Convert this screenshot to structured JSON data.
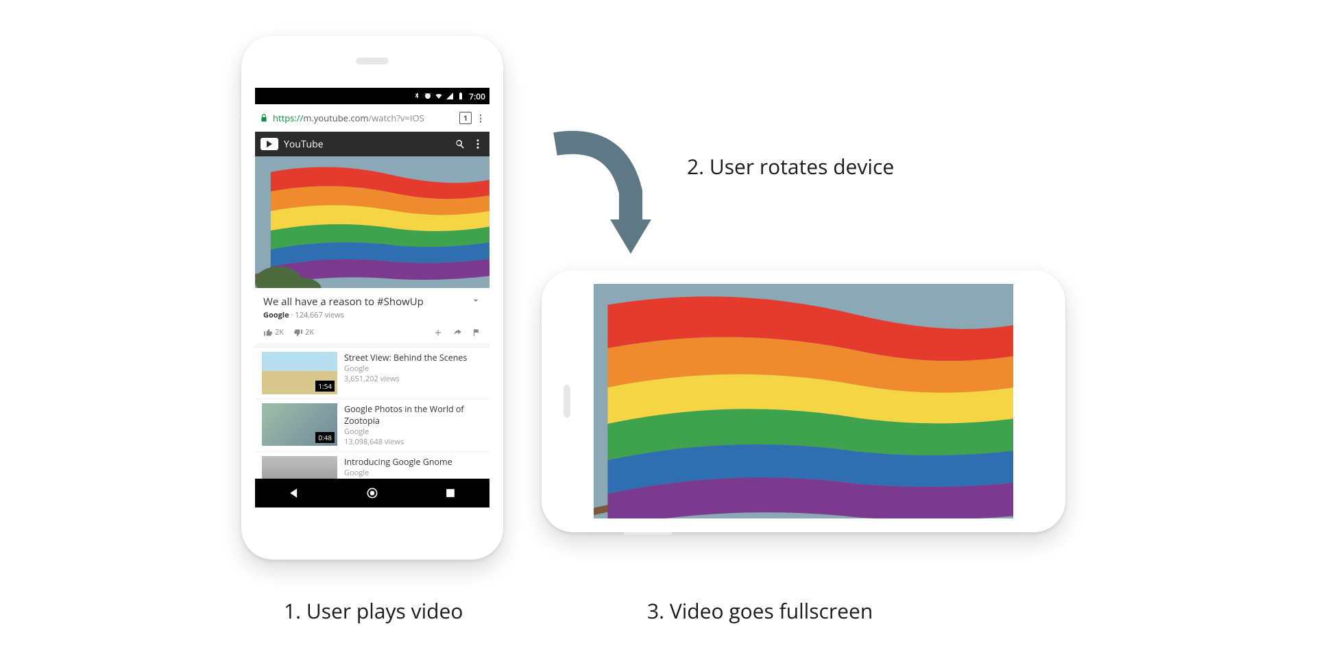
{
  "captions": {
    "step1": "1. User plays video",
    "step2": "2. User rotates device",
    "step3": "3. Video goes fullscreen"
  },
  "statusbar": {
    "time": "7:00"
  },
  "omnibox": {
    "protocol": "https://",
    "host": "m.youtube.com",
    "path": "/watch?v=IOS",
    "tab_count": "1",
    "menu_glyph": "⋮"
  },
  "ytbar": {
    "brand": "YouTube"
  },
  "video": {
    "title": "We all have a reason to #ShowUp",
    "channel": "Google",
    "views_sep": " · ",
    "views": "124,667 views",
    "likes": "2K",
    "dislikes": "2K"
  },
  "suggestions": [
    {
      "title": "Street View: Behind the Scenes",
      "channel": "Google",
      "views": "3,651,202 views",
      "duration": "1:54",
      "thumb": "t1"
    },
    {
      "title": "Google Photos in the World of Zootopia",
      "channel": "Google",
      "views": "13,098,648 views",
      "duration": "0:48",
      "thumb": "t2"
    },
    {
      "title": "Introducing Google Gnome",
      "channel": "Google",
      "views": "",
      "duration": "",
      "thumb": "t3"
    }
  ]
}
